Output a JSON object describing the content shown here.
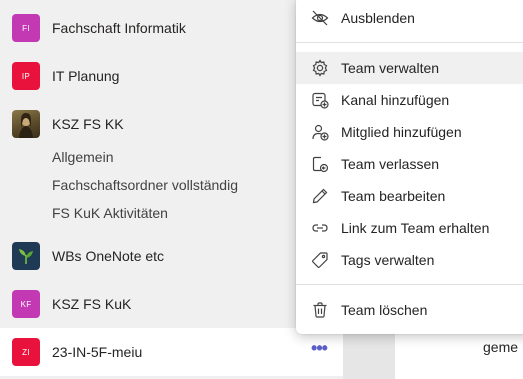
{
  "teams": [
    {
      "name": "Fachschaft Informatik",
      "initials": "FI",
      "color": "#c239b3"
    },
    {
      "name": "IT Planung",
      "initials": "IP",
      "color": "#e8123c"
    },
    {
      "name": "KSZ FS KK",
      "initials": "",
      "color": "#6b5433",
      "image": "mona-lisa"
    },
    {
      "name": "WBs OneNote etc",
      "initials": "",
      "color": "#1f3a55",
      "image": "plant"
    },
    {
      "name": "KSZ FS KuK",
      "initials": "KF",
      "color": "#c239b3"
    },
    {
      "name": "23-IN-5F-meiu",
      "initials": "ZI",
      "color": "#e8123c"
    }
  ],
  "channels": [
    "Allgemein",
    "Fachschaftsordner vollständig",
    "FS KuK Aktivitäten"
  ],
  "more_options": "•••",
  "menu": {
    "items": [
      {
        "label": "Ausblenden",
        "icon": "eye-off-icon"
      },
      {
        "label": "Team verwalten",
        "icon": "gear-icon"
      },
      {
        "label": "Kanal hinzufügen",
        "icon": "add-channel-icon"
      },
      {
        "label": "Mitglied hinzufügen",
        "icon": "add-person-icon"
      },
      {
        "label": "Team verlassen",
        "icon": "leave-icon"
      },
      {
        "label": "Team bearbeiten",
        "icon": "pencil-icon"
      },
      {
        "label": "Link zum Team erhalten",
        "icon": "link-icon"
      },
      {
        "label": "Tags verwalten",
        "icon": "tag-icon"
      },
      {
        "label": "Team löschen",
        "icon": "trash-icon"
      }
    ]
  },
  "background_text": "geme",
  "colors": {
    "accent": "#5b5fc7",
    "hover": "#f0f0f0"
  }
}
